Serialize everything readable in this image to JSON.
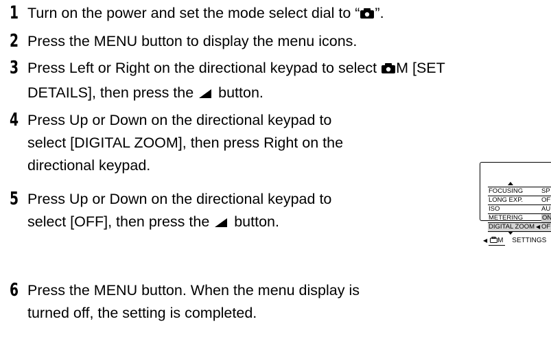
{
  "steps": [
    {
      "num": "1",
      "line1_pre": "Turn on the power and set the mode select dial to “",
      "line1_post": "”."
    },
    {
      "num": "2",
      "line1": "Press the MENU button to display the menu icons."
    },
    {
      "num": "3",
      "line1_pre": "Press Left or Right on the directional keypad to select ",
      "line1_post": "M [SET",
      "line2_pre": "DETAILS], then press the ",
      "line2_post": " button."
    },
    {
      "num": "4",
      "line1": "Press Up or Down on the directional keypad to",
      "line2": "select [DIGITAL ZOOM], then press Right on the",
      "line3": "directional keypad."
    },
    {
      "num": "5",
      "line1": "Press Up or Down on the directional keypad to",
      "line2_pre": "select [OFF], then press the ",
      "line2_post": " button."
    },
    {
      "num": "6",
      "line1": "Press the MENU button. When the menu display is",
      "line2": "turned off, the setting is completed."
    }
  ],
  "lcd": {
    "rows": [
      {
        "key": "FOCUSING",
        "value": "SP"
      },
      {
        "key": "LONG EXP.",
        "value": "OF"
      },
      {
        "key": "ISO",
        "value": "AU"
      },
      {
        "key": "METERING",
        "value": "ON"
      },
      {
        "key": "DIGITAL ZOOM",
        "value": "OF"
      }
    ],
    "tab_label": "M",
    "settings_label": "SETTINGS"
  },
  "icons": {
    "camera": "camera-icon",
    "ok_button": "ok-button-icon"
  }
}
